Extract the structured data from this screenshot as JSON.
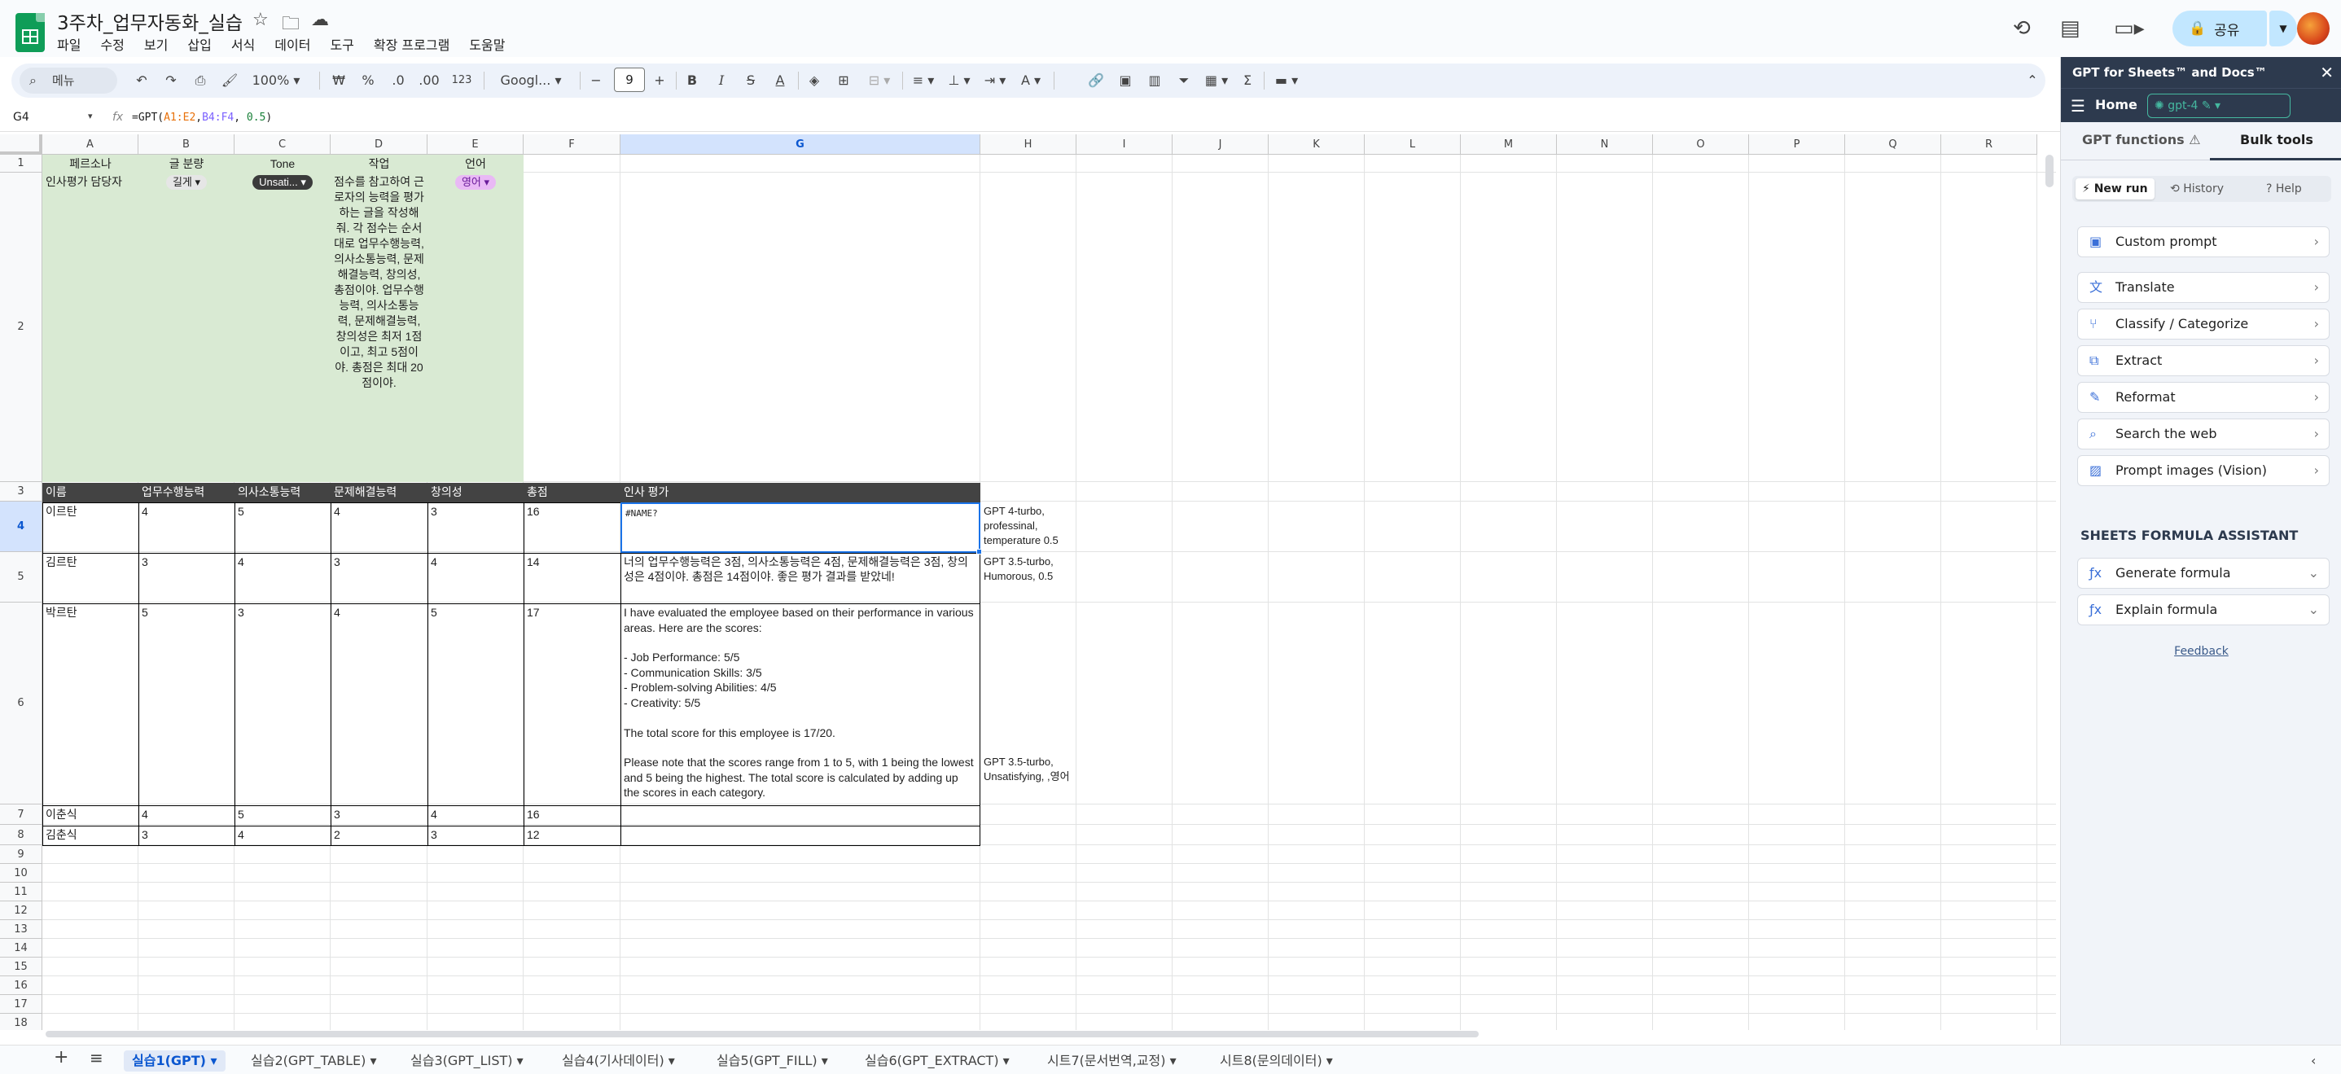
{
  "app": {
    "doc_title": "3주차_업무자동화_실습",
    "menu": [
      "파일",
      "수정",
      "보기",
      "삽입",
      "서식",
      "데이터",
      "도구",
      "확장 프로그램",
      "도움말"
    ],
    "share_label": "공유"
  },
  "toolbar": {
    "menu_search": "메뉴",
    "zoom": "100%",
    "currency": "₩",
    "percent": "%",
    "dec_decrease": ".0",
    "dec_increase": ".00",
    "number_format": "123",
    "font": "Googl...",
    "font_size": "9"
  },
  "formula_bar": {
    "cell_ref": "G4",
    "formula_prefix": "=GPT(",
    "ref1": "A1:E2",
    "comma1": ",",
    "ref2": "B4:F4",
    "comma2": ", ",
    "num": "0.5",
    "formula_suffix": ")"
  },
  "columns": [
    "A",
    "B",
    "C",
    "D",
    "E",
    "F",
    "G",
    "H",
    "I",
    "J",
    "K",
    "L",
    "M",
    "N",
    "O",
    "P",
    "Q",
    "R"
  ],
  "rows": [
    "1",
    "2",
    "3",
    "4",
    "5",
    "6",
    "7",
    "8",
    "9",
    "10",
    "11",
    "12",
    "13",
    "14",
    "15",
    "16",
    "17",
    "18"
  ],
  "sheet": {
    "r1": {
      "a": "페르소나",
      "b": "글 분량",
      "c": "Tone",
      "d": "작업",
      "e": "언어"
    },
    "r2": {
      "a": "인사평가 담당자",
      "b": "길게",
      "c": "Unsati...",
      "d": "점수를 참고하여 근로자의 능력을 평가하는 글을 작성해줘. 각 점수는 순서대로 업무수행능력, 의사소통능력, 문제해결능력, 창의성, 총점이야. 업무수행능력, 의사소통능력, 문제해결능력, 창의성은 최저 1점이고, 최고 5점이야. 총점은 최대 20점이야.",
      "e": "영어"
    },
    "r3": {
      "a": "이름",
      "b": "업무수행능력",
      "c": "의사소통능력",
      "d": "문제해결능력",
      "e": "창의성",
      "f": "총점",
      "g": "인사 평가"
    },
    "r4": {
      "a": "이르탄",
      "b": "4",
      "c": "5",
      "d": "4",
      "e": "3",
      "f": "16",
      "g": "#NAME?",
      "h": "GPT 4-turbo, professinal, temperature 0.5"
    },
    "r5": {
      "a": "김르탄",
      "b": "3",
      "c": "4",
      "d": "3",
      "e": "4",
      "f": "14",
      "g": "너의 업무수행능력은 3점, 의사소통능력은 4점, 문제해결능력은 3점, 창의성은 4점이야. 총점은 14점이야. 좋은 평가 결과를 받았네!",
      "h": "GPT 3.5-turbo, Humorous, 0.5"
    },
    "r6": {
      "a": "박르탄",
      "b": "5",
      "c": "3",
      "d": "4",
      "e": "5",
      "f": "17",
      "g1": "I have evaluated the employee based on their performance in various areas. Here are the scores:",
      "g2": "- Job Performance: 5/5",
      "g3": "- Communication Skills: 3/5",
      "g4": "- Problem-solving Abilities: 4/5",
      "g5": "- Creativity: 5/5",
      "g6": "The total score for this employee is 17/20.",
      "g7": "Please note that the scores range from 1 to 5, with 1 being the lowest and 5 being the highest. The total score is calculated by adding up the scores in each category.",
      "h": "GPT 3.5-turbo, Unsatisfying, ,영어"
    },
    "r7": {
      "a": "이춘식",
      "b": "4",
      "c": "5",
      "d": "3",
      "e": "4",
      "f": "16"
    },
    "r8": {
      "a": "김춘식",
      "b": "3",
      "c": "4",
      "d": "2",
      "e": "3",
      "f": "12"
    }
  },
  "sheet_tabs": [
    "실습1(GPT)",
    "실습2(GPT_TABLE)",
    "실습3(GPT_LIST)",
    "실습4(기사데이터)",
    "실습5(GPT_FILL)",
    "실습6(GPT_EXTRACT)",
    "시트7(문서번역,교정)",
    "시트8(문의데이터)"
  ],
  "panel": {
    "title": "GPT for Sheets™ and Docs™",
    "home": "Home",
    "model": "gpt-4",
    "tab_functions": "GPT functions",
    "tab_bulk": "Bulk tools",
    "subtab_new": "New run",
    "subtab_history": "History",
    "subtab_help": "Help",
    "items": [
      "Custom prompt",
      "Translate",
      "Classify / Categorize",
      "Extract",
      "Reformat",
      "Search the web",
      "Prompt images (Vision)"
    ],
    "sfa_title": "SHEETS FORMULA ASSISTANT",
    "sfa_items": [
      "Generate formula",
      "Explain formula"
    ],
    "feedback": "Feedback"
  },
  "colors": {
    "accent": "#0b57d0",
    "green_fill": "#d9ead3",
    "dark_fill": "#434343",
    "panel_dark": "#2d3a4e"
  }
}
